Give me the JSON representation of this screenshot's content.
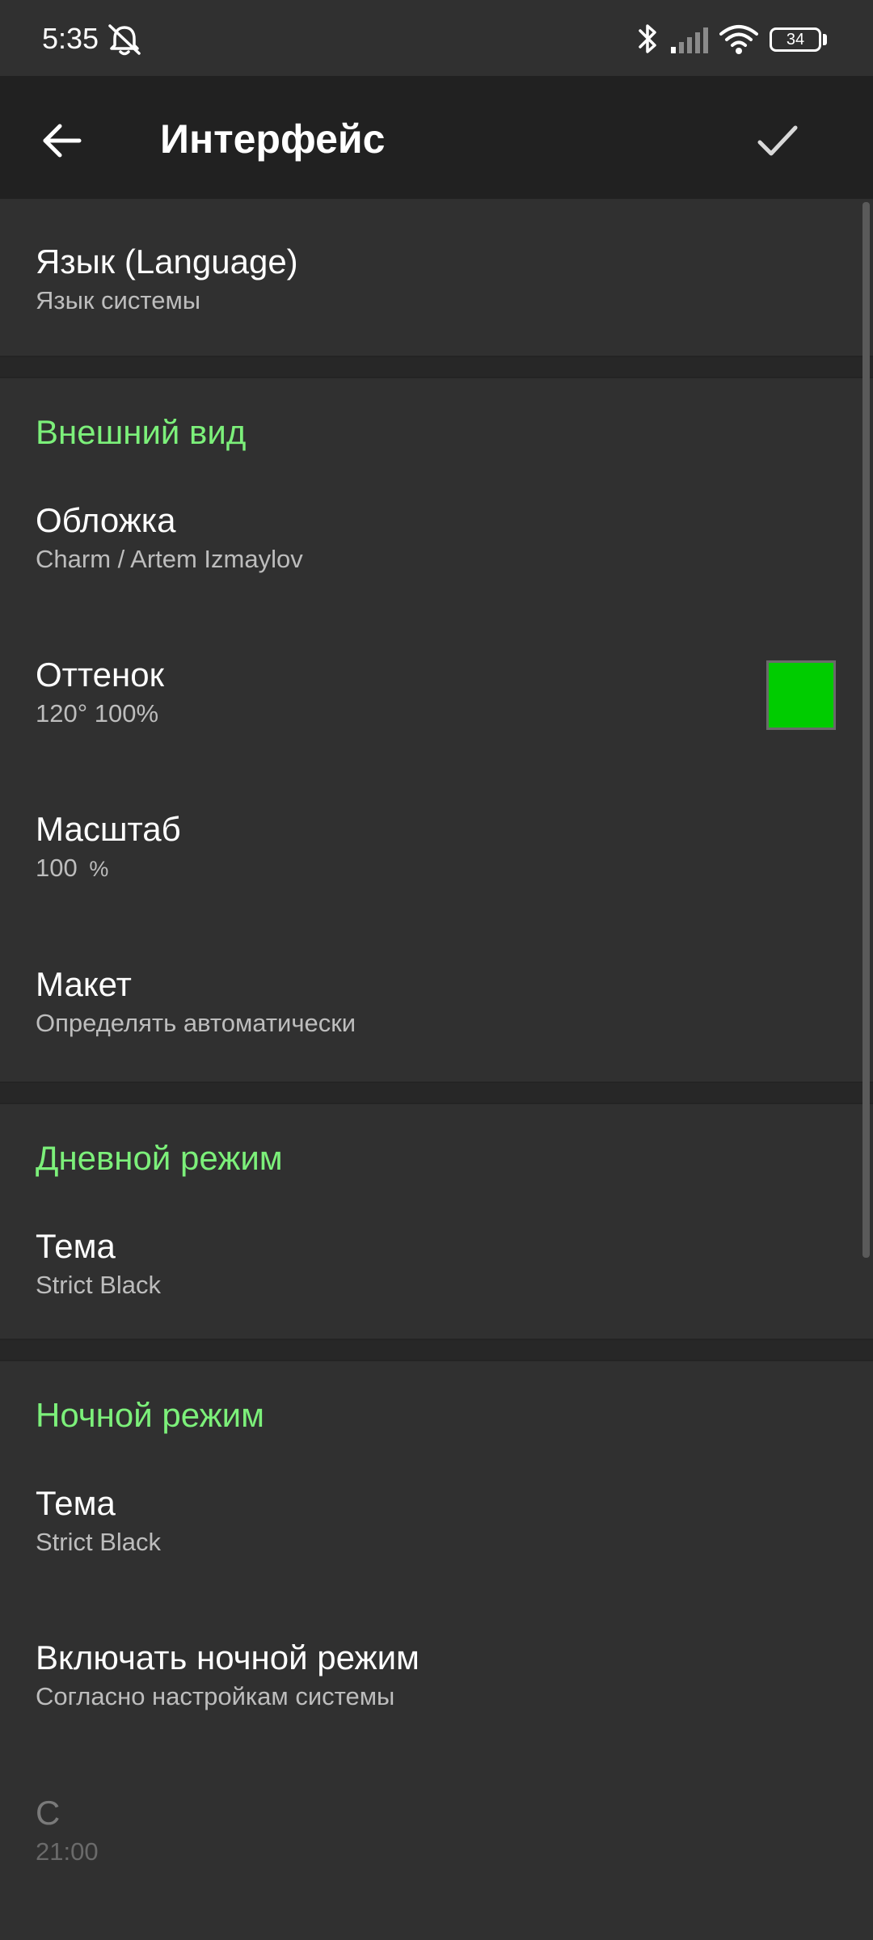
{
  "status_bar": {
    "time": "5:35",
    "battery": "34",
    "icons": [
      "alarm-off-icon",
      "bluetooth-icon",
      "signal-icon",
      "wifi-icon",
      "battery-icon"
    ]
  },
  "toolbar": {
    "title": "Интерфейс",
    "back_icon": "arrow-left-icon",
    "confirm_icon": "check-icon"
  },
  "language": {
    "title": "Язык (Language)",
    "value": "Язык системы"
  },
  "appearance": {
    "header": "Внешний вид",
    "cover": {
      "title": "Обложка",
      "value": "Charm / Artem Izmaylov"
    },
    "tint": {
      "title": "Оттенок",
      "value": "120° 100%",
      "color": "#00cc00"
    },
    "scale": {
      "title": "Масштаб",
      "value": "100",
      "unit": "%"
    },
    "layout": {
      "title": "Макет",
      "value": "Определять автоматически"
    }
  },
  "day_mode": {
    "header": "Дневной режим",
    "theme": {
      "title": "Тема",
      "value": "Strict Black"
    }
  },
  "night_mode": {
    "header": "Ночной режим",
    "theme": {
      "title": "Тема",
      "value": "Strict Black"
    },
    "enable": {
      "title": "Включать ночной режим",
      "value": "Согласно настройкам системы"
    },
    "from": {
      "title": "С",
      "value": "21:00"
    }
  },
  "colors": {
    "accent": "#7cf07a",
    "background": "#2f2f2f",
    "toolbar": "#212121"
  }
}
